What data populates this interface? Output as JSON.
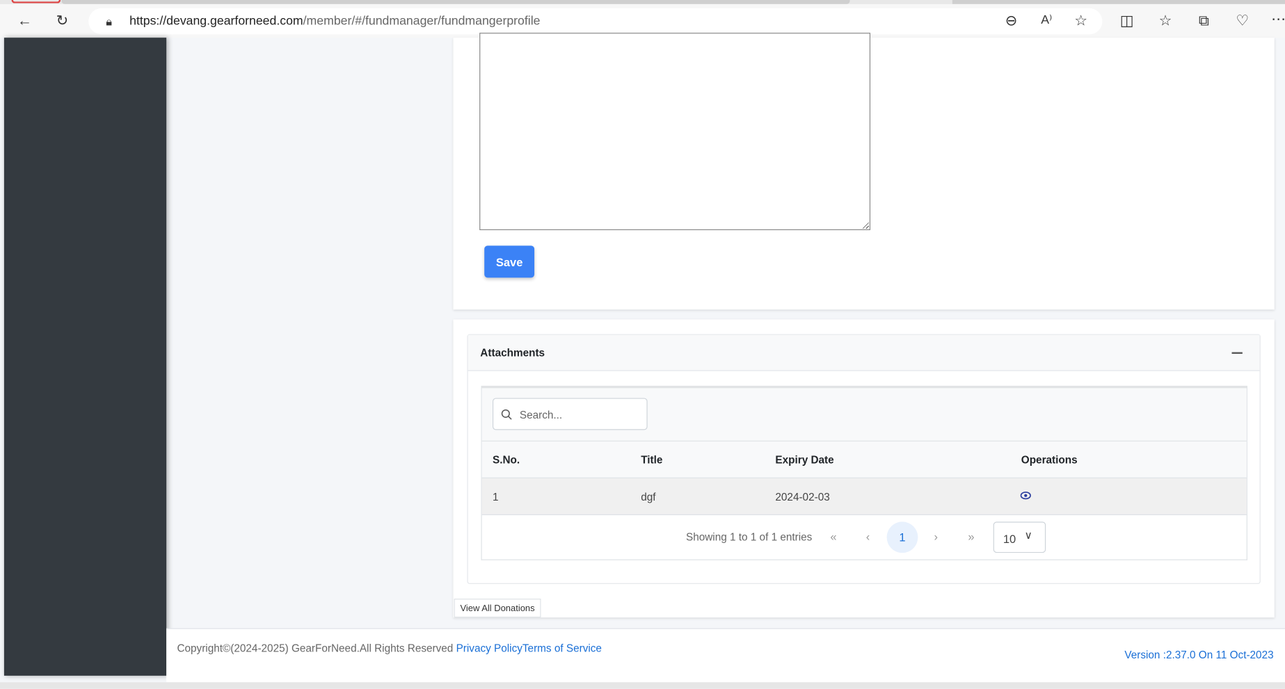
{
  "browser": {
    "url_host": "https://devang.gearforneed.com",
    "url_path": "/member/#/fundmanager/fundmangerprofile",
    "icons": [
      "back-icon",
      "refresh-icon",
      "lock-icon",
      "zoom-out-icon",
      "read-aloud-icon",
      "favorite-star-icon",
      "split-screen-icon",
      "favorites-icon",
      "collections-icon",
      "browser-essentials-icon",
      "more-icon"
    ]
  },
  "form": {
    "save_label": "Save"
  },
  "attachments": {
    "title": "Attachments",
    "collapse_icon": "minus-icon",
    "search_placeholder": "Search...",
    "columns": [
      "S.No.",
      "Title",
      "Expiry Date",
      "Operations"
    ],
    "rows": [
      {
        "sno": "1",
        "title": "dgf",
        "expiry": "2024-02-03",
        "operation_icon": "eye-icon"
      }
    ],
    "showing": "Showing 1 to 1 of 1 entries",
    "current_page": "1",
    "page_size": "10"
  },
  "view_all_donations": "View All Donations",
  "footer": {
    "copyright": "Copyright©(2024-2025) GearForNeed.All Rights Reserved ",
    "privacy": "Privacy Policy",
    "terms": "Terms of Service",
    "version": "Version :2.37.0 On 11 Oct-2023"
  },
  "colors": {
    "sidebar": "#343a40",
    "primary": "#3b82f6",
    "link": "#1a6fd6"
  }
}
